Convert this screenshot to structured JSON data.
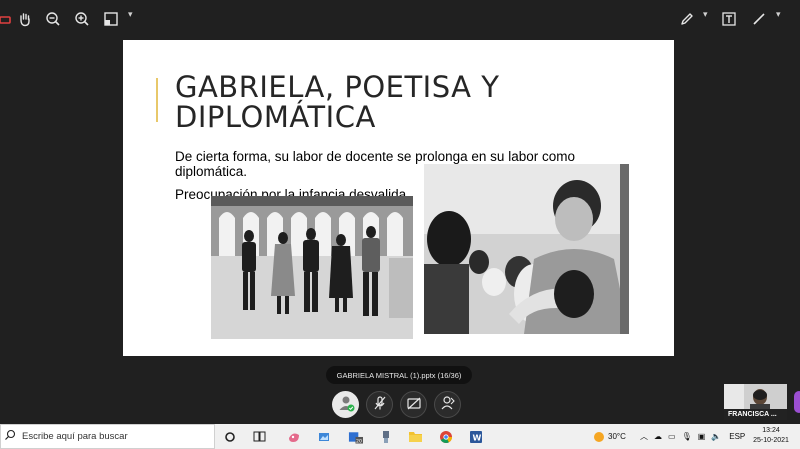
{
  "toolbar": {
    "left_icons": [
      "eraser-icon",
      "hand-pan-icon",
      "zoom-out-icon",
      "zoom-in-icon",
      "fit-page-icon"
    ],
    "right_icons": [
      "pen-icon",
      "text-box-icon",
      "line-icon"
    ]
  },
  "slide": {
    "title_line1": "GABRIELA, POETISA Y",
    "title_line2": "DIPLOMÁTICA",
    "body": [
      "De cierta forma, su labor de docente se prolonga en su labor como diplomática.",
      "Preocupación por la infancia desvalida."
    ],
    "accent_color": "#e8c86a"
  },
  "file_label": "GABRIELA MISTRAL (1).pptx   (16/36)",
  "call_controls": [
    "user-status-icon",
    "mic-off-icon",
    "video-off-icon",
    "share-icon"
  ],
  "participant": {
    "name": "FRANCISCA ..."
  },
  "taskbar": {
    "search_placeholder": "Escribe aquí para buscar",
    "weather": "30°C",
    "language": "ESP",
    "time": "13:24",
    "date": "25-10-2021"
  }
}
